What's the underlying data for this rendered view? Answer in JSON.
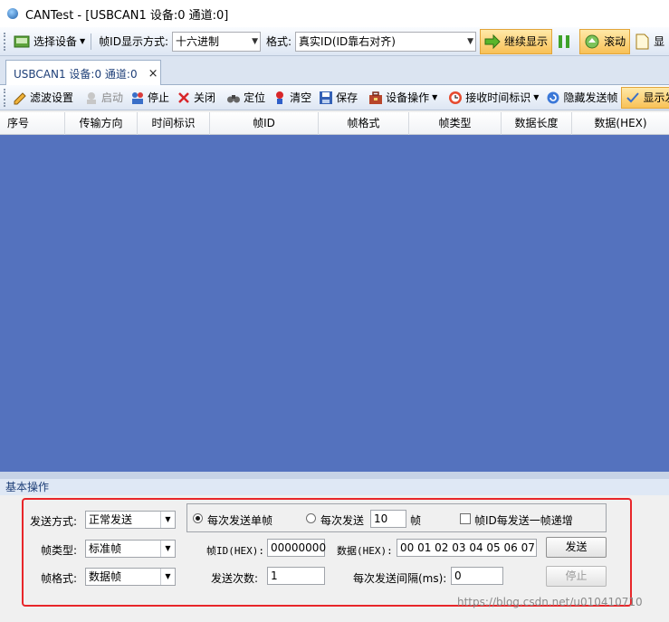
{
  "window": {
    "title": "CANTest  - [USBCAN1 设备:0 通道:0]"
  },
  "toolbar1": {
    "select_device": "选择设备",
    "frame_id_display_label": "帧ID显示方式:",
    "frame_id_display_value": "十六进制",
    "format_label": "格式:",
    "format_value": "真实ID(ID靠右对齐)",
    "continue_display": "继续显示",
    "scroll": "滚动",
    "display_cut": "显"
  },
  "doc_tab": {
    "label": "USBCAN1 设备:0 通道:0",
    "close": "×"
  },
  "toolbar2": {
    "filter": "滤波设置",
    "start": "启动",
    "stop": "停止",
    "close": "关闭",
    "locate": "定位",
    "clear": "清空",
    "save": "保存",
    "device_ops": "设备操作",
    "rx_time": "接收时间标识",
    "hide_send": "隐藏发送帧",
    "display_cut": "显示发"
  },
  "grid": {
    "columns": [
      "序号",
      "传输方向",
      "时间标识",
      "帧ID",
      "帧格式",
      "帧类型",
      "数据长度",
      "数据(HEX)"
    ]
  },
  "panel": {
    "title": "基本操作",
    "send_mode_label": "发送方式:",
    "send_mode_value": "正常发送",
    "single_frame_label": "每次发送单帧",
    "multi_frame_label": "每次发送",
    "multi_frame_count": "10",
    "multi_frame_unit": "帧",
    "increment_label": "帧ID每发送一帧递增",
    "frame_type_label": "帧类型:",
    "frame_type_value": "标准帧",
    "frame_id_label": "帧ID(HEX):",
    "frame_id_value": "00000000",
    "data_label": "数据(HEX):",
    "data_value": "00 01 02 03 04 05 06 07",
    "send_button": "发送",
    "frame_format_label": "帧格式:",
    "frame_format_value": "数据帧",
    "send_count_label": "发送次数:",
    "send_count_value": "1",
    "interval_label": "每次发送间隔(ms):",
    "interval_value": "0",
    "stop_button": "停止"
  },
  "watermark": "https://blog.csdn.net/u010410710"
}
